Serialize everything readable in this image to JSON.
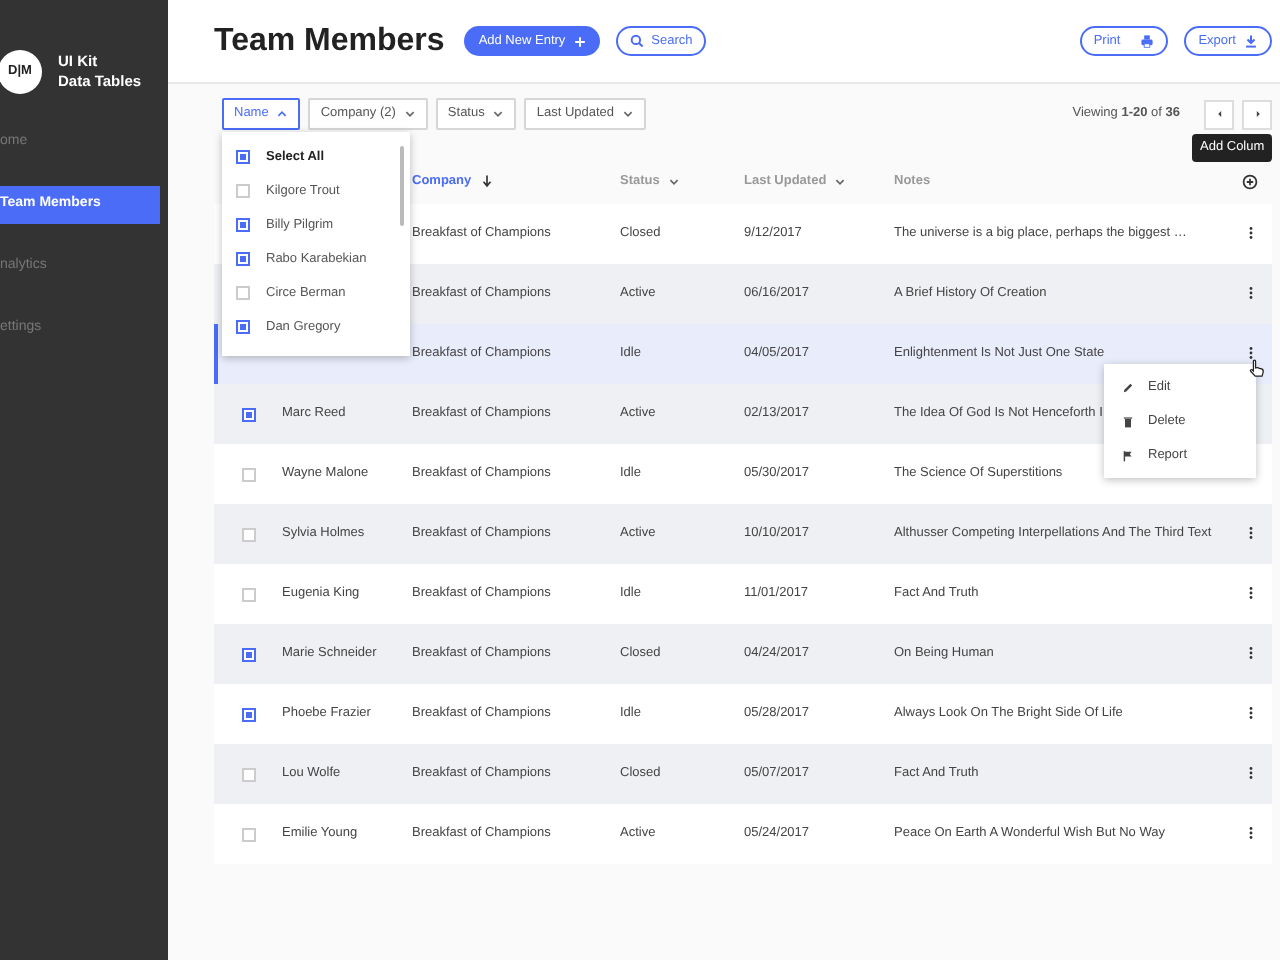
{
  "sidebar": {
    "logo": "D|M",
    "brand": [
      "UI Kit",
      "Data Tables"
    ],
    "items": [
      {
        "label": "ome",
        "selected": false
      },
      {
        "label": "Team Members",
        "selected": true
      },
      {
        "label": "nalytics",
        "selected": false
      },
      {
        "label": "ettings",
        "selected": false
      }
    ]
  },
  "header": {
    "title": "Team Members",
    "add_button": "Add New Entry",
    "search_button": "Search",
    "print_button": "Print",
    "export_button": "Export"
  },
  "filters": [
    {
      "label": "Name",
      "open": true
    },
    {
      "label": "Company (2)",
      "open": false
    },
    {
      "label": "Status",
      "open": false
    },
    {
      "label": "Last Updated",
      "open": false
    }
  ],
  "pagination": {
    "text": "Viewing **1-20** of **36**"
  },
  "tooltip": "Add Colum",
  "table": {
    "columns": [
      {
        "label": "Company",
        "kind": "sort",
        "active": true
      },
      {
        "label": "Status",
        "kind": "filter",
        "active": false
      },
      {
        "label": "Last Updated",
        "kind": "filter",
        "active": false
      },
      {
        "label": "Notes",
        "kind": "plain",
        "active": false
      }
    ],
    "rows": [
      {
        "company": "Breakfast of Champions",
        "status": "Closed",
        "updated": "9/12/2017",
        "notes": "The universe is a big place, perhaps the biggest …",
        "selected": false
      },
      {
        "company": "Breakfast of Champions",
        "status": "Active",
        "updated": "06/16/2017",
        "notes": "A Brief History Of Creation",
        "selected": false
      },
      {
        "company": "Breakfast of Champions",
        "status": "Idle",
        "updated": "04/05/2017",
        "notes": "Enlightenment Is Not Just One State",
        "selected": true
      },
      {
        "checked": true,
        "name": "Marc Reed",
        "company": "Breakfast of Champions",
        "status": "Active",
        "updated": "02/13/2017",
        "notes": "The Idea Of God Is Not Henceforth I",
        "selected": false,
        "menu_visible": false
      },
      {
        "checked": false,
        "name": "Wayne Malone",
        "company": "Breakfast of Champions",
        "status": "Idle",
        "updated": "05/30/2017",
        "notes": "The Science Of Superstitions",
        "selected": false,
        "menu_visible": false
      },
      {
        "checked": false,
        "name": "Sylvia Holmes",
        "company": "Breakfast of Champions",
        "status": "Active",
        "updated": "10/10/2017",
        "notes": "Althusser Competing Interpellations And The Third Text",
        "selected": false
      },
      {
        "checked": false,
        "name": "Eugenia King",
        "company": "Breakfast of Champions",
        "status": "Idle",
        "updated": "11/01/2017",
        "notes": "Fact And Truth",
        "selected": false
      },
      {
        "checked": true,
        "name": "Marie Schneider",
        "company": "Breakfast of Champions",
        "status": "Closed",
        "updated": "04/24/2017",
        "notes": "On Being Human",
        "selected": false
      },
      {
        "checked": true,
        "name": "Phoebe Frazier",
        "company": "Breakfast of Champions",
        "status": "Idle",
        "updated": "05/28/2017",
        "notes": "Always Look On The Bright Side Of Life",
        "selected": false
      },
      {
        "checked": false,
        "name": "Lou Wolfe",
        "company": "Breakfast of Champions",
        "status": "Closed",
        "updated": "05/07/2017",
        "notes": "Fact And Truth",
        "selected": false
      },
      {
        "checked": false,
        "name": "Emilie Young",
        "company": "Breakfast of Champions",
        "status": "Active",
        "updated": "05/24/2017",
        "notes": "Peace On Earth A Wonderful Wish But No Way",
        "selected": false
      }
    ]
  },
  "name_dropdown": [
    {
      "label": "Select All",
      "checked": true
    },
    {
      "label": "Kilgore Trout",
      "checked": false
    },
    {
      "label": "Billy Pilgrim",
      "checked": true
    },
    {
      "label": "Rabo Karabekian",
      "checked": true
    },
    {
      "label": "Circe Berman",
      "checked": false
    },
    {
      "label": "Dan Gregory",
      "checked": true
    }
  ],
  "row_menu": [
    {
      "label": "Edit",
      "kind": "edit"
    },
    {
      "label": "Delete",
      "kind": "delete"
    },
    {
      "label": "Report",
      "kind": "report"
    }
  ]
}
